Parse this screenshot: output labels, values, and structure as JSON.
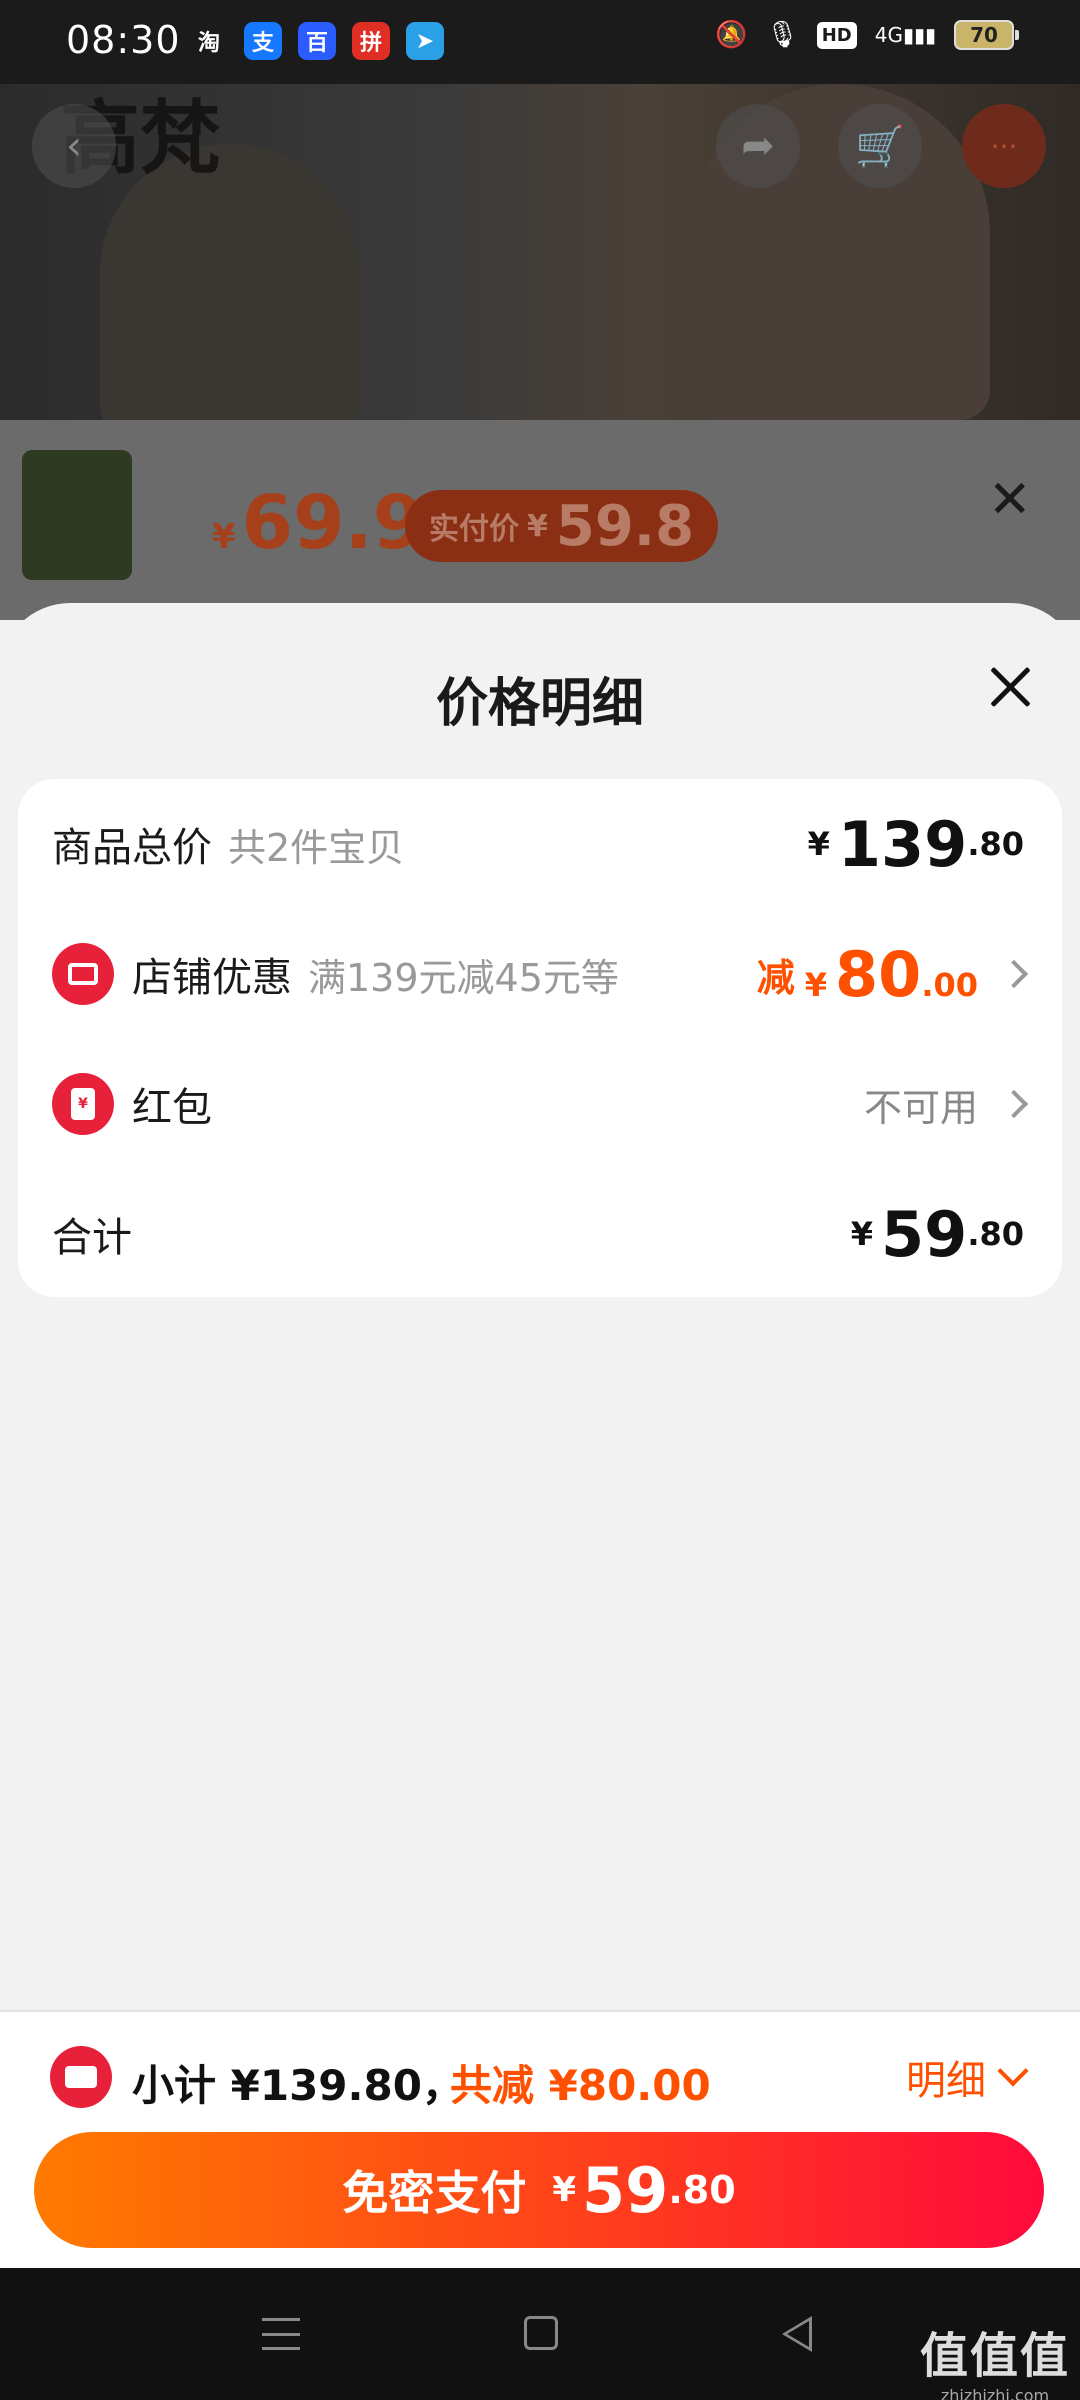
{
  "status_bar": {
    "time": "08:30",
    "apps": [
      {
        "name": "taobao",
        "glyph": "淘",
        "color": "#1b1b1b"
      },
      {
        "name": "alipay",
        "glyph": "支",
        "color": "#1677ff"
      },
      {
        "name": "baidu",
        "glyph": "百",
        "color": "#2b5cff"
      },
      {
        "name": "pinduoduo",
        "glyph": "拼",
        "color": "#e02e24"
      },
      {
        "name": "telegram",
        "glyph": "➤",
        "color": "#2aa1e6"
      }
    ],
    "hd": "HD",
    "network": "4G",
    "battery": "70"
  },
  "background_product": {
    "brand_text": "高梵",
    "price_symbol": "¥",
    "price": "69.9",
    "real_price_label": "实付价",
    "real_price_symbol": "¥",
    "real_price": "59.8"
  },
  "sheet": {
    "title": "价格明细",
    "rows": {
      "total": {
        "label": "商品总价",
        "sub": "共2件宝贝",
        "symbol": "¥",
        "int": "139",
        "dec": ".80"
      },
      "store_discount": {
        "label": "店铺优惠",
        "sub": "满139元减45元等",
        "prefix": "减",
        "symbol": "¥",
        "int": "80",
        "dec": ".00"
      },
      "red_packet": {
        "label": "红包",
        "value": "不可用",
        "icon_glyph": "¥"
      },
      "sum": {
        "label": "合计",
        "symbol": "¥",
        "int": "59",
        "dec": ".80"
      }
    }
  },
  "bottom": {
    "subtotal_text": "小计 ¥139.80，",
    "reduced_text": "共减 ¥80.00",
    "detail_label": "明细",
    "pay_label": "免密支付",
    "pay_symbol": "¥",
    "pay_int": "59",
    "pay_dec": ".80"
  },
  "watermark": {
    "big": "值值值",
    "small": "zhizhizhi.com"
  },
  "colors": {
    "accent": "#ff5000",
    "brand_red": "#e8213a"
  }
}
